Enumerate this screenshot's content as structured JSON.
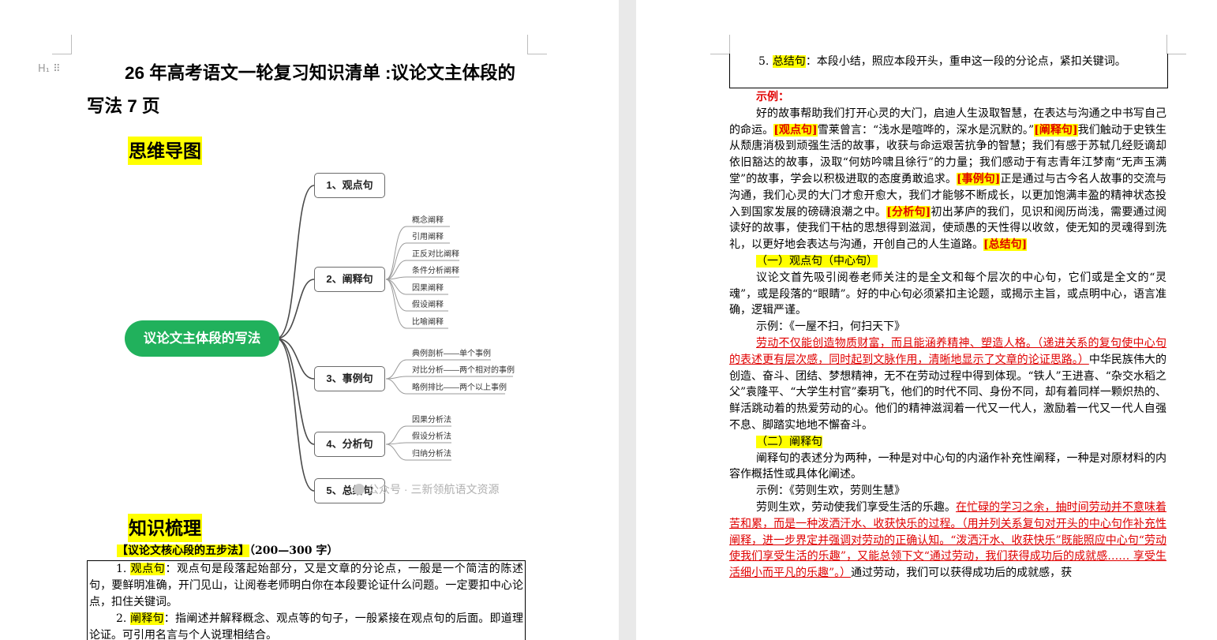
{
  "left_page": {
    "title": "26 年高考语文一轮复习知识清单 :议论文主体段的写法 7 页",
    "title_line1": "26 年高考语文一轮复习知识清单 :议论文主体段的",
    "title_line2": "写法 7 页",
    "heading_icon": "H₁ ⠿",
    "section_mindmap": "思维导图",
    "mindmap": {
      "root": "议论文主体段的写法",
      "nodes": [
        {
          "label": "1、观点句",
          "children": []
        },
        {
          "label": "2、阐释句",
          "children": [
            "概念阐释",
            "引用阐释",
            "正反对比阐释",
            "条件分析阐释",
            "因果阐释",
            "假设阐释",
            "比喻阐释"
          ]
        },
        {
          "label": "3、事例句",
          "children": [
            "典例剖析——单个事例",
            "对比分析——两个相对的事例",
            "略例排比——两个以上事例"
          ]
        },
        {
          "label": "4、分析句",
          "children": [
            "因果分析法",
            "假设分析法",
            "归纳分析法"
          ]
        },
        {
          "label": "5、总结句",
          "children": []
        }
      ],
      "watermark": "公众号 · 三新领航语文资源"
    },
    "section_knowledge": "知识梳理",
    "five_steps_title": "【议论文核心段的五步法】",
    "five_steps_range": "（200—300 字）",
    "box_items": [
      {
        "num": "1.",
        "term": "观点句",
        "text": "：观点句是段落起始部分，又是文章的分论点，一般是一个简洁的陈述句，要鲜明准确，开门见山，让阅卷老师明白你在本段要论证什么问题。一定要扣中心论点，扣住关键词。"
      },
      {
        "num": "2.",
        "term": "阐释句",
        "text": "：指阐述并解释概念、观点等的句子，一般紧接在观点句的后面。即道理论证。可引用名言与个人说理相结合。"
      }
    ]
  },
  "right_page": {
    "box_item5": {
      "num": "5.",
      "term": "总结句",
      "text": "：本段小结，照应本段开头，重申这一段的分论点，紧扣关键词。"
    },
    "example_label": "示例：",
    "example_para": {
      "p1": "好的故事帮助我们打开心灵的大门，启迪人生汲取智慧，在表达与沟通之中书写自己的命运。",
      "tag1": "[观点句]",
      "p2": "雪莱曾言：“浅水是喧哗的，深水是沉默的。”",
      "tag2": "[阐释句]",
      "p3": "我们触动于史铁生从颓唐消极到顽强生活的故事，收获与命运艰苦抗争的智慧；我们有感于苏轼几经贬谪却依旧豁达的故事，汲取“何妨吟啸且徐行”的力量；我们感动于有志青年江梦南“无声玉满堂”的故事，学会以积极进取的态度勇敢追求。",
      "tag3": "[事例句]",
      "p4": "正是通过与古今名人故事的交流与沟通，我们心灵的大门才愈开愈大，我们才能够不断成长，以更加饱满丰盈的精神状态投入到国家发展的磅礴浪潮之中。",
      "tag4": "[分析句]",
      "p5": "初出茅庐的我们，见识和阅历尚浅，需要通过阅读好的故事，使我们干枯的思想得到滋润，使顽愚的天性得以收敛，使无知的灵魂得到洗礼，以更好地会表达与沟通，开创自己的人生道路。",
      "tag5": "[总结句]"
    },
    "sub1_title": "（一）观点句（中心句）",
    "sub1_text": "议论文首先吸引阅卷老师关注的是全文和每个层次的中心句，它们或是全文的“灵魂”，或是段落的“眼睛”。好的中心句必须紧扣主论题，或揭示主旨，或点明中心，语言准确，逻辑严谨。",
    "sub1_example": "示例：《一屋不扫，何扫天下》",
    "sub1_red": "劳动不仅能创造物质财富，而且能涵养精神、塑造人格。（递进关系的复句使中心句的表述更有层次感，同时起到文脉作用，清晰地显示了文章的论证思路。）",
    "sub1_rest": "中华民族伟大的创造、奋斗、团结、梦想精神，无不在劳动过程中得到体现。“铁人”王进喜、“杂交水稻之父”袁隆平、“大学生村官”秦玥飞，他们的时代不同、身份不同，却有着同样一颗炽热的、鲜活跳动着的热爱劳动的心。他们的精神滋润着一代又一代人，激励着一代又一代人自强不息、脚踏实地地不懈奋斗。",
    "sub2_title": "（二）阐释句",
    "sub2_text": "阐释句的表述分为两种，一种是对中心句的内涵作补充性阐释，一种是对原材料的内容作概括性或具体化阐述。",
    "sub2_example": "示例：《劳则生欢，劳则生慧》",
    "sub2_p1": "劳则生欢，劳动使我们享受生活的乐趣。",
    "sub2_red": "在忙碌的学习之余，抽时间劳动并不意味着苦和累，而是一种泼洒汗水、收获快乐的过程。（用并列关系复句对开头的中心句作补充性阐释，进一步界定并强调对劳动的正确认知。“泼洒汗水、收获快乐”既能照应中心句“劳动使我们享受生活的乐趣”，又能总领下文“通过劳动，我们获得成功后的成就感…… 享受生活细小而平凡的乐趣”。）",
    "sub2_rest": "通过劳动，我们可以获得成功后的成就感，获"
  },
  "colors": {
    "highlight": "#ffff00",
    "red": "#e00000",
    "root_green": "#21b15c"
  }
}
